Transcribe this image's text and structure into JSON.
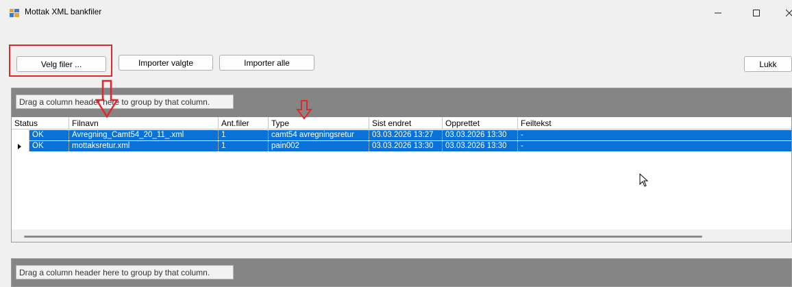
{
  "window": {
    "title": "Mottak XML bankfiler",
    "icon": "app-window-icon"
  },
  "toolbar": {
    "velg_filer": "Velg filer ...",
    "importer_valgte": "Importer valgte",
    "importer_alle": "Importer alle",
    "lukk": "Lukk"
  },
  "grid1": {
    "group_hint": "Drag a column header here to group by that column.",
    "columns": [
      "Status",
      "Filnavn",
      "Ant.filer",
      "Type",
      "Sist endret",
      "Opprettet",
      "Feiltekst"
    ],
    "rows": [
      {
        "status": "OK",
        "filnavn": "Avregning_Camt54_20_11_.xml",
        "antfiler": "1",
        "type": "camt54 avregningsretur",
        "sist_endret": "03.03.2026 13:27",
        "opprettet": "03.03.2026 13:30",
        "feiltekst": "-"
      },
      {
        "status": "OK",
        "filnavn": "mottaksretur.xml",
        "antfiler": "1",
        "type": "pain002",
        "sist_endret": "03.03.2026 13:30",
        "opprettet": "03.03.2026 13:30",
        "feiltekst": "-"
      }
    ]
  },
  "grid2": {
    "group_hint": "Drag a column header here to group by that column."
  },
  "colors": {
    "selection": "#0a72d6",
    "annotation_red": "#e3262a",
    "group_panel": "#858585"
  }
}
